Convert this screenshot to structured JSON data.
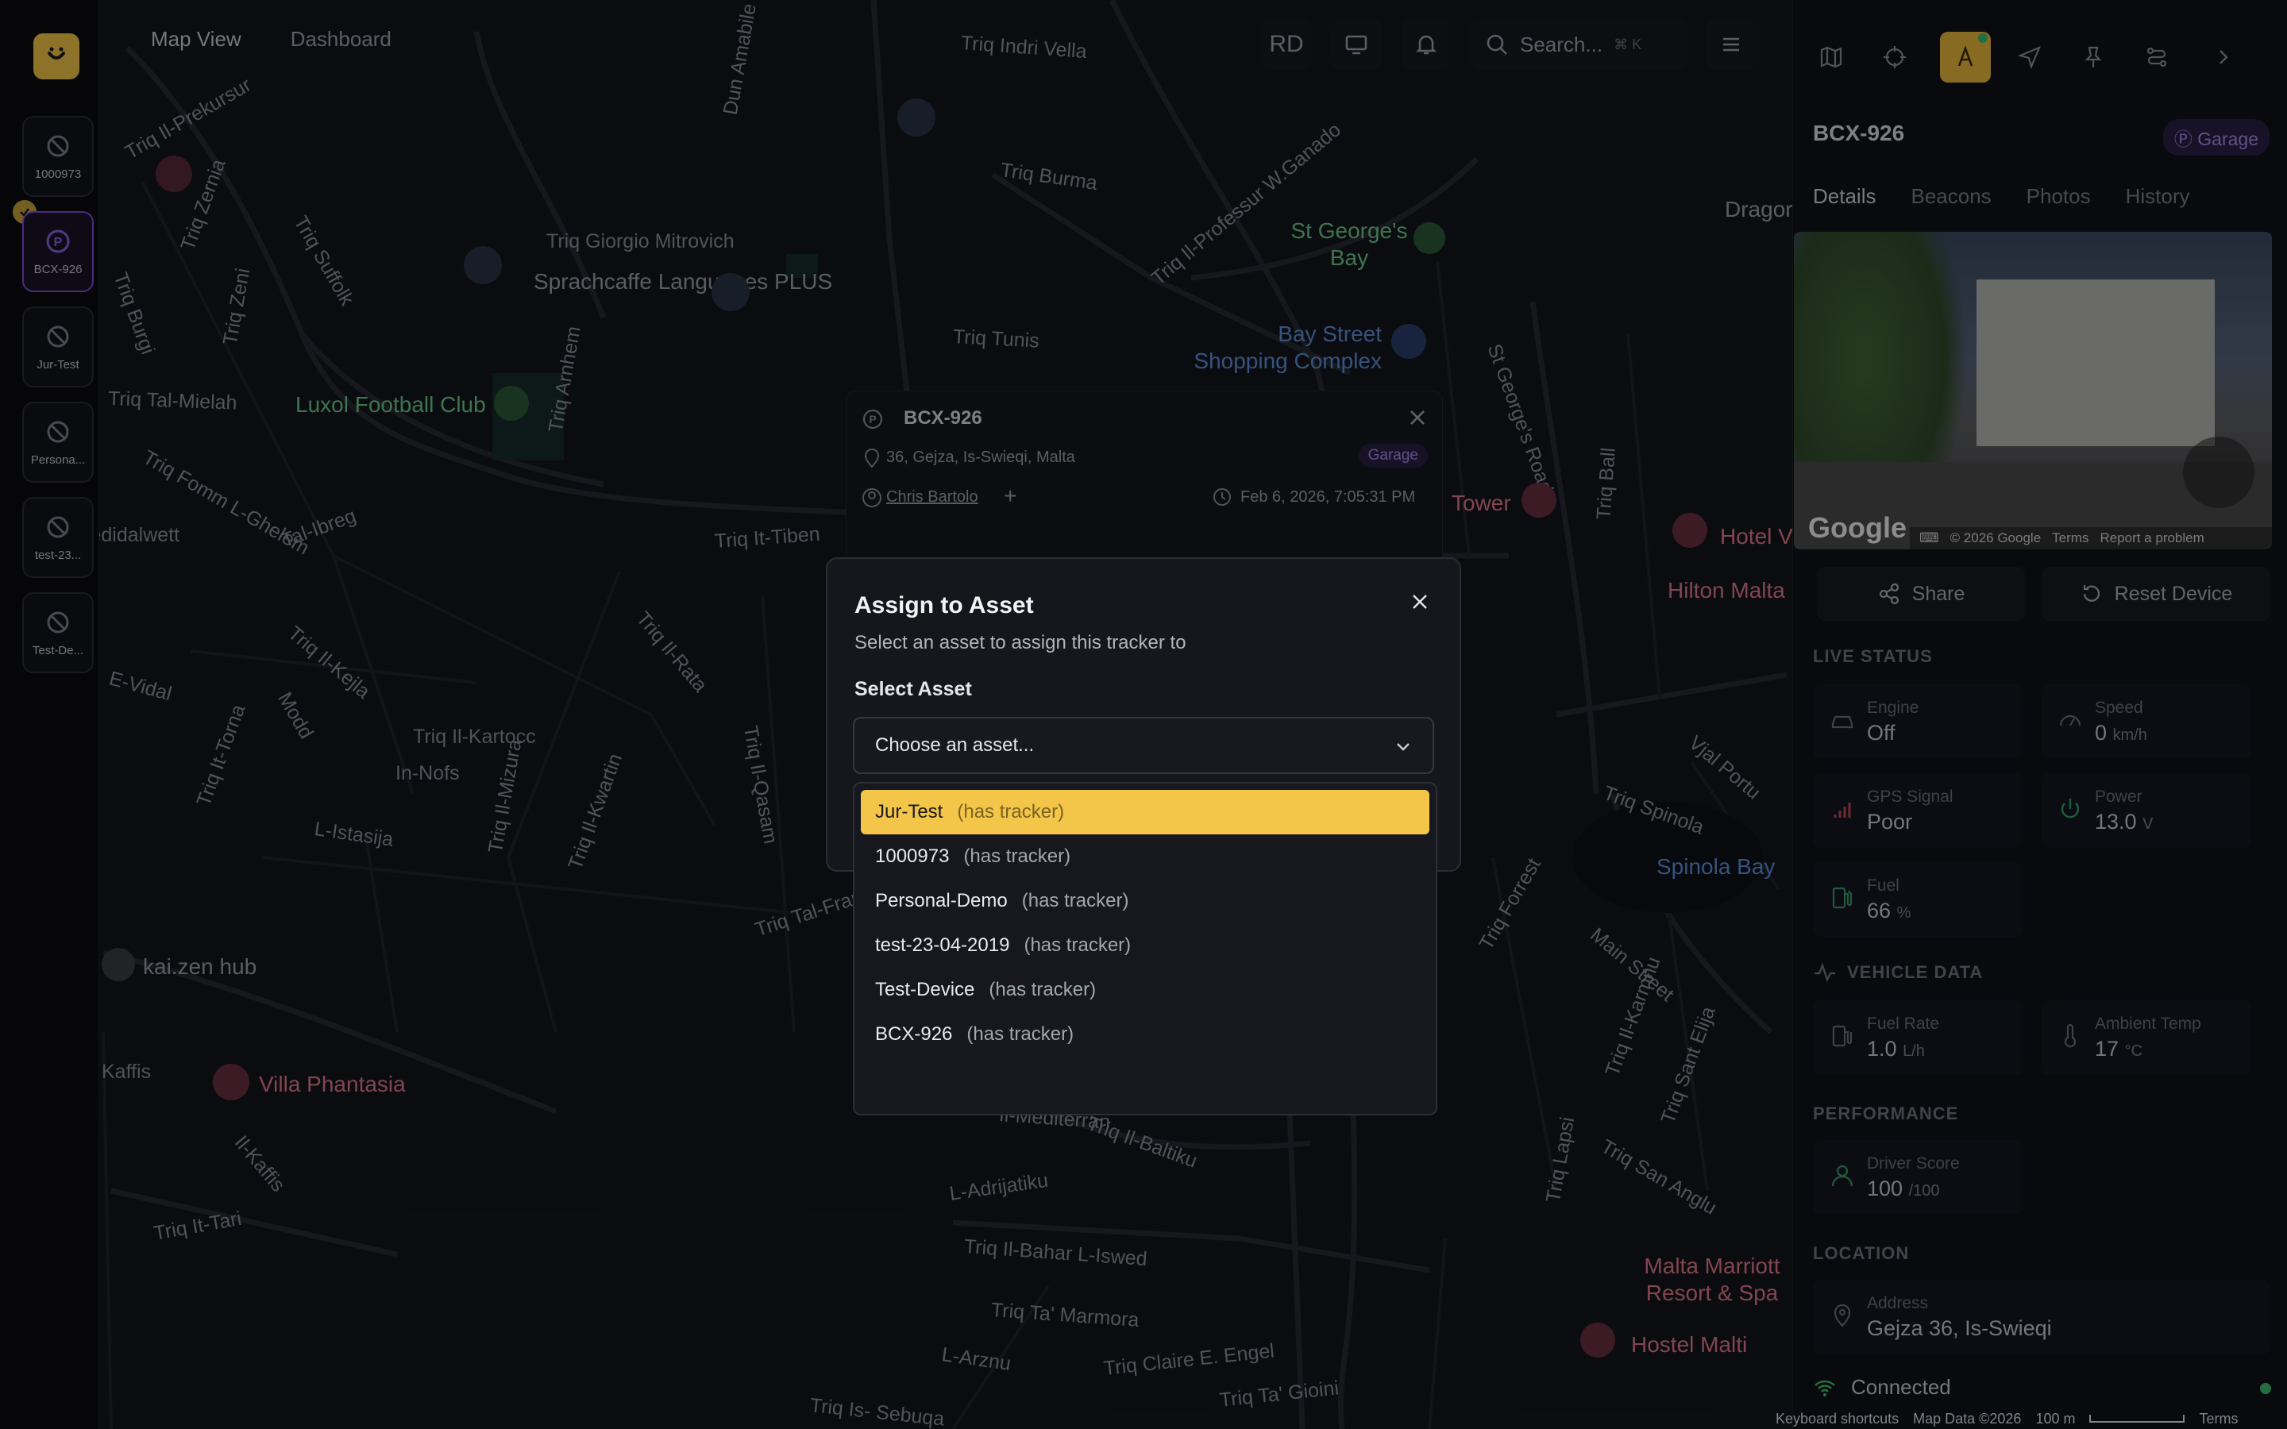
{
  "nav": {
    "tabs": [
      "Map View",
      "Dashboard"
    ],
    "user_initials": "RD",
    "search_placeholder": "Search...",
    "search_shortcut": "⌘ K"
  },
  "devices": [
    {
      "label": "1000973"
    },
    {
      "label": "BCX-926"
    },
    {
      "label": "Jur-Test"
    },
    {
      "label": "Persona..."
    },
    {
      "label": "test-23..."
    },
    {
      "label": "Test-De..."
    }
  ],
  "map": {
    "streets": [
      "Triq Indri Vella",
      "Triq Burma",
      "Triq Giorgio Mitrovich",
      "Triq Tunis",
      "Triq Tal-Mielah",
      "Triq Arnhem",
      "Triq It-Tiben",
      "Triq Il-Kartocc",
      "In-Nofs",
      "L-Istasija",
      "Triq Fomm L-Ghelem",
      "Il-Pedidalwett",
      "Tal-Ibreg",
      "Triq Il-Kejla",
      "Modd",
      "Triq It-Torna",
      "Triq Il-Mizura",
      "Triq Il-Kwartin",
      "Triq Il-Qasam",
      "Triq Il-Rata",
      "Triq Tal-Francizi",
      "Triq Spinola",
      "Vjal Portu",
      "Triq San Anglu",
      "Triq Il-Bahar L-Iswed",
      "Triq Ta' Marmora",
      "L-Arznu",
      "Triq Claire E. Engel",
      "Triq Ta' Gioini",
      "Triq Is- Sebuqa",
      "L-Adrijatiku",
      "Il-Mediterran",
      "Triq Il-Baltiku",
      "Triq It-Tari",
      "Kaffis",
      "Il-Kaffis",
      "Triq Suffolk",
      "Triq Il-Professur W.Ganado",
      "St George's Road",
      "Triq Ball",
      "Triq Forrest",
      "Main Street",
      "Triq Lapsi",
      "Triq Il-Karmnu",
      "Triq Sant Elija",
      "E-Vidal",
      "Triq Il-Prekursur",
      "Triq Zernia",
      "Triq Burgi",
      "Triq Zeni",
      "Dun Amabile"
    ],
    "pois": {
      "sprachcaffe": "Sprachcaffe Languages PLUS",
      "luxol": "Luxol Football Club",
      "st_georges_bay": "St George's Bay",
      "bay_street": "Bay Street Shopping Complex",
      "tower": "Tower",
      "hilton": "Hilton Malta",
      "hotel": "Hotel V",
      "spinola_bay": "Spinola Bay",
      "kaizen": "kai.zen hub",
      "villa": "Villa Phantasia",
      "marriott": "Malta Marriott Resort & Spa",
      "hostel": "Hostel Malti",
      "dragonara": "Dragor"
    }
  },
  "popup": {
    "title": "BCX-926",
    "address": "36, Gejza, Is-Swieqi, Malta",
    "badge": "Garage",
    "driver": "Chris Bartolo",
    "timestamp": "Feb 6, 2026, 7:05:31 PM"
  },
  "modal": {
    "title": "Assign to Asset",
    "subtitle": "Select an asset to assign this tracker to",
    "label": "Select Asset",
    "placeholder": "Choose an asset...",
    "options": [
      {
        "name": "Jur-Test",
        "hint": "(has tracker)"
      },
      {
        "name": "1000973",
        "hint": "(has tracker)"
      },
      {
        "name": "Personal-Demo",
        "hint": "(has tracker)"
      },
      {
        "name": "test-23-04-2019",
        "hint": "(has tracker)"
      },
      {
        "name": "Test-Device",
        "hint": "(has tracker)"
      },
      {
        "name": "BCX-926",
        "hint": "(has tracker)"
      }
    ]
  },
  "panel": {
    "title": "BCX-926",
    "badge": "Garage",
    "tabs": [
      "Details",
      "Beacons",
      "Photos",
      "History"
    ],
    "streetview": {
      "brand": "Google",
      "copyright": "© 2026 Google",
      "terms": "Terms",
      "report": "Report a problem"
    },
    "share_label": "Share",
    "reset_label": "Reset Device",
    "live_status_title": "LIVE STATUS",
    "engine": {
      "k": "Engine",
      "v": "Off"
    },
    "speed": {
      "k": "Speed",
      "v": "0",
      "u": "km/h"
    },
    "gps": {
      "k": "GPS Signal",
      "v": "Poor"
    },
    "power": {
      "k": "Power",
      "v": "13.0",
      "u": "V"
    },
    "fuel": {
      "k": "Fuel",
      "v": "66",
      "u": "%"
    },
    "vehicle_data_title": "VEHICLE DATA",
    "fuel_rate": {
      "k": "Fuel Rate",
      "v": "1.0",
      "u": "L/h"
    },
    "ambient": {
      "k": "Ambient Temp",
      "v": "17",
      "u": "°C"
    },
    "performance_title": "PERFORMANCE",
    "driver_score": {
      "k": "Driver Score",
      "v": "100",
      "u": "/100"
    },
    "location_title": "LOCATION",
    "address": {
      "k": "Address",
      "v": "Gejza 36, Is-Swieqi"
    },
    "connection": "Connected"
  },
  "footer": {
    "shortcuts": "Keyboard shortcuts",
    "mapdata": "Map Data ©2026",
    "scale": "100 m",
    "terms": "Terms"
  },
  "colors": {
    "accent": "#f3c549",
    "purple": "#7c4ddb",
    "bg": "#14161d"
  }
}
